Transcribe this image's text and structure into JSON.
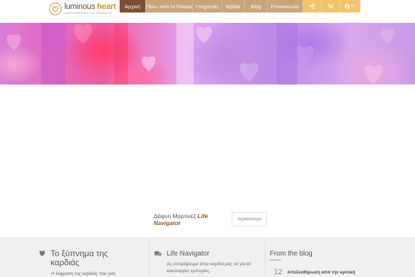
{
  "header": {
    "logo": {
      "name_light": "luminous ",
      "name_bold": "heart",
      "subtitle": "ΔΑΦΝΗ ΜΑΡΤΙΝΕΖ LIFE NAVIGATOR"
    },
    "nav": [
      {
        "label": "Αρχική",
        "active": true
      },
      {
        "label": "Πίσω από το Όνομα",
        "active": false
      },
      {
        "label": "Υπηρεσίες",
        "active": false
      },
      {
        "label": "Βιβλία",
        "active": false
      },
      {
        "label": "Blog",
        "active": false
      },
      {
        "label": "Επικοινωνία",
        "active": false
      }
    ],
    "icons": {
      "login": "sign-in-icon",
      "cart": "cart-icon",
      "language": "globe-icon"
    },
    "language_label": "EL"
  },
  "hero": {
    "image": "pink-purple-hearts-painting"
  },
  "info": {
    "tagline_prefix": "Δάφνη Μαρτινέζ ",
    "tagline_emph": "Life Navigator",
    "more_label": "περισσότερα"
  },
  "footer": {
    "col1": {
      "icon": "heart-icon",
      "title": "Το ξύπνημα της καρδιάς",
      "text": "Η έκφραση της καρδιάς που μας"
    },
    "col2": {
      "icon": "chat-bubbles-icon",
      "title": "Life Navigator",
      "text": "Ας επιτρέψουμε στην καρδιά μας να γευτεί καινούργιες εμπειρίες."
    },
    "col3": {
      "title": "From the blog",
      "post_day": "12",
      "post_title": "Απελευθέρωση από την κριτική"
    }
  },
  "colors": {
    "nav_bg": "#c9a57a",
    "nav_active": "#7a4f33",
    "nav_icon_bg": "#f2c46a",
    "accent": "#8a5a22",
    "footer_bg": "#f0f0f0"
  }
}
